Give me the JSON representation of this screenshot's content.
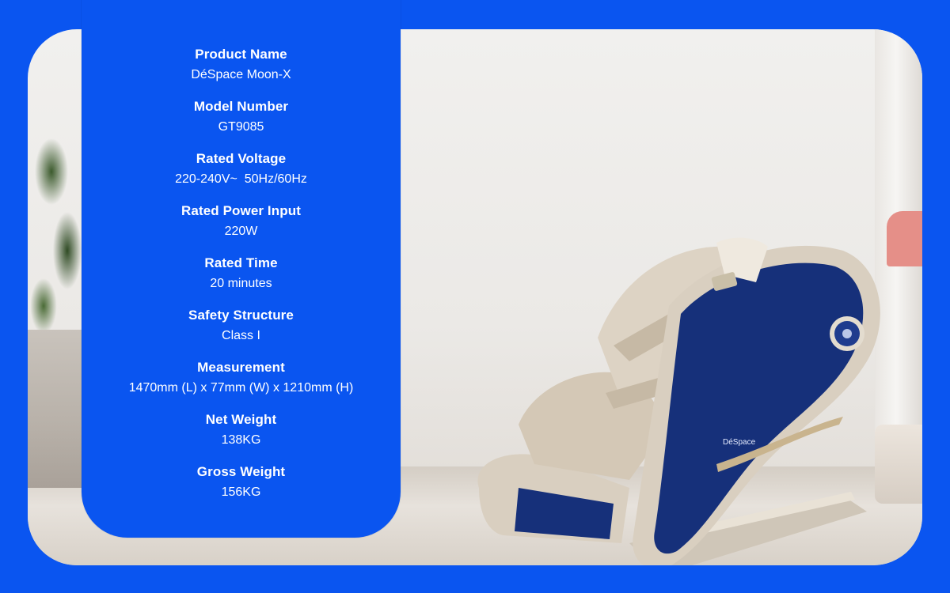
{
  "specs": [
    {
      "label": "Product Name",
      "value": "DéSpace Moon-X"
    },
    {
      "label": "Model Number",
      "value": "GT9085"
    },
    {
      "label": "Rated Voltage",
      "value": "220-240V~  50Hz/60Hz"
    },
    {
      "label": "Rated Power Input",
      "value": "220W"
    },
    {
      "label": "Rated Time",
      "value": "20 minutes"
    },
    {
      "label": "Safety Structure",
      "value": "Class I"
    },
    {
      "label": "Measurement",
      "value": "1470mm (L) x 77mm (W) x 1210mm (H)"
    },
    {
      "label": "Net Weight",
      "value": "138KG"
    },
    {
      "label": "Gross Weight",
      "value": "156KG"
    }
  ],
  "chair_brand": "DéSpace",
  "colors": {
    "background_blue": "#0a55f0",
    "chair_navy": "#16307a",
    "chair_cream": "#d9cfc0",
    "text": "#ffffff"
  }
}
